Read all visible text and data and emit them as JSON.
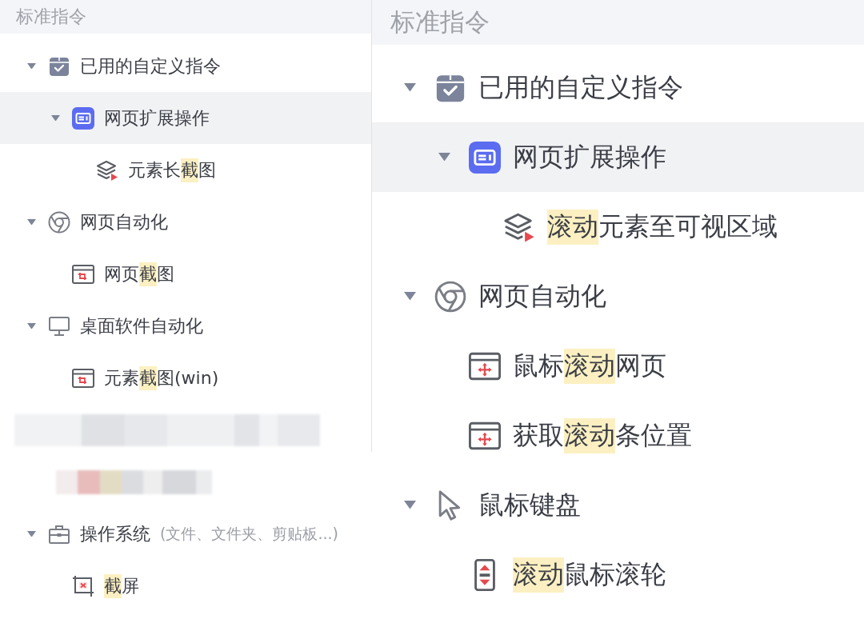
{
  "panels": [
    {
      "header": "标准指令",
      "tree": [
        {
          "kind": "custom",
          "label": [
            {
              "text": "已用的自定义指令",
              "highlighted": false
            }
          ],
          "selected": false,
          "expanded": true,
          "children": [
            {
              "kind": "extension",
              "label": [
                {
                  "text": "网页扩展操作",
                  "highlighted": false
                }
              ],
              "selected": true,
              "expanded": true,
              "children": [
                {
                  "kind": "layers",
                  "label": [
                    {
                      "text": "元素长",
                      "highlighted": false
                    },
                    {
                      "text": "截",
                      "highlighted": true
                    },
                    {
                      "text": "图",
                      "highlighted": false
                    }
                  ],
                  "selected": false
                }
              ]
            }
          ]
        },
        {
          "kind": "web",
          "label": [
            {
              "text": "网页自动化",
              "highlighted": false
            }
          ],
          "selected": false,
          "expanded": true,
          "children": [
            {
              "kind": "capture",
              "label": [
                {
                  "text": "网页",
                  "highlighted": false
                },
                {
                  "text": "截",
                  "highlighted": true
                },
                {
                  "text": "图",
                  "highlighted": false
                }
              ],
              "selected": false
            }
          ]
        },
        {
          "kind": "desktop",
          "label": [
            {
              "text": "桌面软件自动化",
              "highlighted": false
            }
          ],
          "selected": false,
          "expanded": true,
          "children": [
            {
              "kind": "capture",
              "label": [
                {
                  "text": "元素",
                  "highlighted": false
                },
                {
                  "text": "截",
                  "highlighted": true
                },
                {
                  "text": "图(win)",
                  "highlighted": false
                }
              ],
              "selected": false
            }
          ]
        },
        {
          "kind": "redacted",
          "expanded": true,
          "children": [
            {
              "kind": "redacted"
            }
          ]
        },
        {
          "kind": "system",
          "label": [
            {
              "text": "操作系统",
              "highlighted": false
            }
          ],
          "note": "(文件、文件夹、剪贴板...)",
          "selected": false,
          "expanded": true,
          "children": [
            {
              "kind": "screenshot",
              "label": [
                {
                  "text": "截",
                  "highlighted": true
                },
                {
                  "text": "屏",
                  "highlighted": false
                }
              ],
              "selected": false
            }
          ]
        }
      ]
    },
    {
      "header": "标准指令",
      "tree": [
        {
          "kind": "custom",
          "label": [
            {
              "text": "已用的自定义指令",
              "highlighted": false
            }
          ],
          "selected": false,
          "expanded": true,
          "children": [
            {
              "kind": "extension",
              "label": [
                {
                  "text": "网页扩展操作",
                  "highlighted": false
                }
              ],
              "selected": true,
              "expanded": true,
              "children": [
                {
                  "kind": "layers",
                  "label": [
                    {
                      "text": "滚动",
                      "highlighted": true
                    },
                    {
                      "text": "元素至可视区域",
                      "highlighted": false
                    }
                  ],
                  "selected": false
                }
              ]
            }
          ]
        },
        {
          "kind": "web",
          "label": [
            {
              "text": "网页自动化",
              "highlighted": false
            }
          ],
          "selected": false,
          "expanded": true,
          "children": [
            {
              "kind": "scroll",
              "label": [
                {
                  "text": "鼠标",
                  "highlighted": false
                },
                {
                  "text": "滚动",
                  "highlighted": true
                },
                {
                  "text": "网页",
                  "highlighted": false
                }
              ],
              "selected": false
            },
            {
              "kind": "scroll",
              "label": [
                {
                  "text": "获取",
                  "highlighted": false
                },
                {
                  "text": "滚动",
                  "highlighted": true
                },
                {
                  "text": "条位置",
                  "highlighted": false
                }
              ],
              "selected": false
            }
          ]
        },
        {
          "kind": "keyboard",
          "label": [
            {
              "text": "鼠标键盘",
              "highlighted": false
            }
          ],
          "selected": false,
          "expanded": true,
          "children": [
            {
              "kind": "wheel",
              "label": [
                {
                  "text": "滚动",
                  "highlighted": true
                },
                {
                  "text": "鼠标滚轮",
                  "highlighted": false
                }
              ],
              "selected": false
            }
          ]
        }
      ]
    }
  ]
}
